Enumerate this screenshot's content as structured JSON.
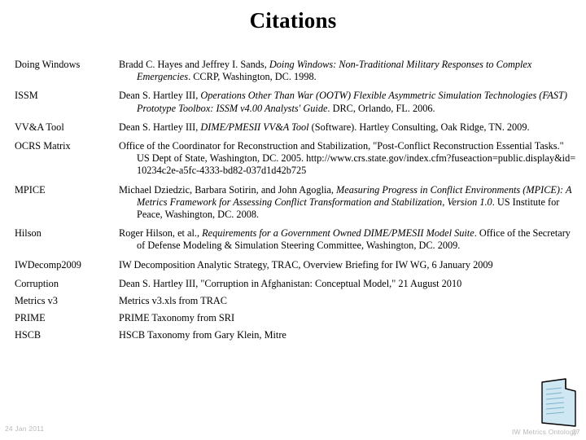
{
  "slide": {
    "title": "Citations",
    "page_number": "27",
    "footer_label": "IW Metrics Ontology",
    "date": "24 Jan 2011",
    "decoration_icon": "document-page-icon"
  },
  "citations": [
    {
      "key": "Doing Windows",
      "line1_plain": "Bradd C. Hayes and Jeffrey I. Sands, ",
      "line1_italic": "Doing Windows: Non-Traditional Military Responses to",
      "line2_italic": "Complex Emergencies",
      "line2_plain": ". CCRP, Washington, DC. 1998."
    },
    {
      "key": "ISSM",
      "line1_plain": "Dean S. Hartley III, ",
      "line1_italic": "Operations Other Than War (OOTW) Flexible Asymmetric Simulation",
      "line2_italic": "Technologies (FAST) Prototype Toolbox: ISSM v4.00 Analysts' Guide",
      "line2_plain": ". DRC, Orlando, FL.",
      "line3_plain": "2006."
    },
    {
      "key": "VV&A Tool",
      "line1_plain": "Dean S. Hartley III, ",
      "line1_italic": "DIME/PMESII VV&A Tool",
      "line1_plain2": " (Software). Hartley Consulting, Oak Ridge,",
      "line2_plain": "TN. 2009."
    },
    {
      "key": "OCRS Matrix",
      "line1_plain": "Office of the Coordinator for Reconstruction and Stabilization, \"Post-Conflict",
      "line2_plain": "Reconstruction Essential Tasks.\" US Dept of State, Washington, DC. 2005.",
      "line3_plain": "http://www.crs.state.gov/index.cfm?fuseaction=public.display&id=10234c2e-a5fc-4333-",
      "line4_plain": "bd82-037d1d42b725"
    },
    {
      "key": "MPICE",
      "line1_plain": "Michael Dziedzic, Barbara Sotirin, and John Agoglia, ",
      "line1_italic": "Measuring Progress in Conflict",
      "line2_italic": "Environments (MPICE): A Metrics Framework for Assessing Conflict Transformation",
      "line3_italic": "and Stabilization, Version 1.0",
      "line3_plain": ". US Institute for Peace, Washington, DC. 2008."
    },
    {
      "key": "Hilson",
      "line1_plain": "Roger Hilson, et al., ",
      "line1_italic": "Requirements for a Government Owned DIME/PMESII Model Suite",
      "line1_plain2": ".",
      "line2_plain": "Office of the Secretary of Defense Modeling & Simulation Steering Committee,",
      "line3_plain": "Washington, DC. 2009."
    },
    {
      "key": "IWDecomp2009",
      "line1_plain": "IW Decomposition Analytic Strategy, TRAC, Overview Briefing for IW WG, 6 January",
      "line2_plain": "2009"
    },
    {
      "key": "Corruption",
      "line1_plain": "Dean S. Hartley III, \"Corruption in Afghanistan: Conceptual Model,\" 21 August 2010"
    },
    {
      "key": "Metrics v3",
      "line1_plain": "Metrics v3.xls from TRAC"
    },
    {
      "key": "PRIME",
      "line1_plain": "PRIME Taxonomy from SRI"
    },
    {
      "key": "HSCB",
      "line1_plain": "HSCB Taxonomy from Gary Klein, Mitre"
    }
  ],
  "colors": {
    "text": "#000000",
    "footer": "#b9b9b9",
    "icon_fill": "#cfe7f2",
    "icon_stroke": "#000000"
  }
}
